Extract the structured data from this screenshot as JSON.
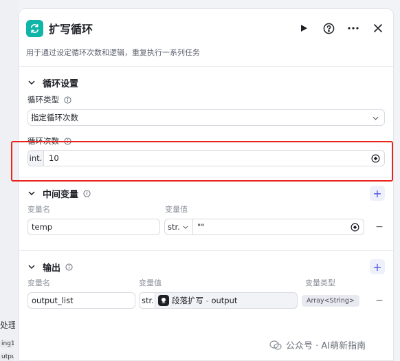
{
  "sidebar_fragments": {
    "label_1": "处理",
    "label_2": "ing1",
    "label_3": "utput"
  },
  "header": {
    "title": "扩写循环",
    "description": "用于通过设定循环次数和逻辑，重复执行一系列任务"
  },
  "loop_settings": {
    "title": "循环设置",
    "loop_type_label": "循环类型",
    "loop_type_value": "指定循环次数",
    "loop_count_label": "循环次数",
    "loop_count_prefix": "int.",
    "loop_count_value": "10"
  },
  "intermediate_vars": {
    "title": "中间变量",
    "col_name": "变量名",
    "col_value": "变量值",
    "rows": [
      {
        "name": "temp",
        "type": "str.",
        "value": "\"\""
      }
    ]
  },
  "output": {
    "title": "输出",
    "col_name": "变量名",
    "col_value": "变量值",
    "col_type": "变量类型",
    "rows": [
      {
        "name": "output_list",
        "type": "str.",
        "ref_node": "段落扩写",
        "ref_sep": " - ",
        "ref_field": "output",
        "var_type": "Array<String>"
      }
    ]
  },
  "watermark": "公众号 · AI萌新指南",
  "colors": {
    "accent": "#4d53e8",
    "node_icon": "#10b5a8",
    "highlight": "#e8231b"
  }
}
